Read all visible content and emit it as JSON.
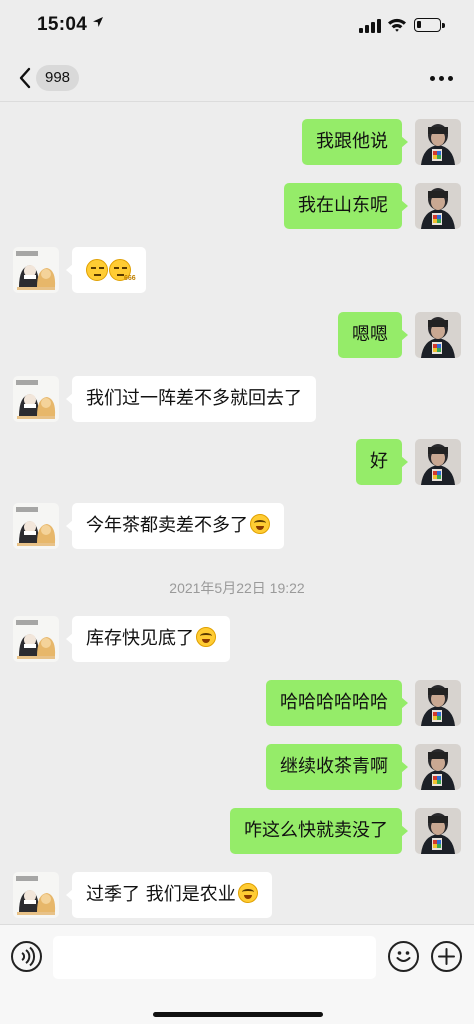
{
  "status_bar": {
    "time": "15:04",
    "location_icon": "location-arrow-icon",
    "signal_icon": "cellular-signal-icon",
    "wifi_icon": "wifi-icon",
    "battery_icon": "battery-icon",
    "battery_level": 0.2
  },
  "nav": {
    "back_icon": "chevron-left-icon",
    "unread_count": "998",
    "more_icon": "more-dots-icon"
  },
  "messages": [
    {
      "side": "out",
      "text": "我跟他说"
    },
    {
      "side": "out",
      "text": "我在山东呢"
    },
    {
      "side": "in",
      "text": "",
      "emoji": [
        "sly-face-emoji",
        "666-emoji"
      ],
      "emoji_label": "666"
    },
    {
      "side": "out",
      "text": "嗯嗯"
    },
    {
      "side": "in",
      "text": "我们过一阵差不多就回去了"
    },
    {
      "side": "out",
      "text": "好"
    },
    {
      "side": "in",
      "text": "今年茶都卖差不多了",
      "emoji": [
        "laugh-cry-emoji"
      ]
    },
    {
      "side": "in",
      "text": "库存快见底了",
      "emoji": [
        "laugh-cry-emoji"
      ]
    },
    {
      "side": "out",
      "text": "哈哈哈哈哈哈"
    },
    {
      "side": "out",
      "text": "继续收茶青啊"
    },
    {
      "side": "out",
      "text": "咋这么快就卖没了"
    },
    {
      "side": "in",
      "text": "过季了 我们是农业",
      "emoji": [
        "laugh-cry-emoji"
      ]
    }
  ],
  "timestamp": "2021年5月22日 19:22",
  "input_bar": {
    "voice_icon": "voice-icon",
    "emoji_icon": "smiley-icon",
    "plus_icon": "plus-circle-icon",
    "text_value": ""
  },
  "colors": {
    "outgoing_bubble": "#95ec69",
    "incoming_bubble": "#ffffff",
    "background": "#ededed"
  }
}
